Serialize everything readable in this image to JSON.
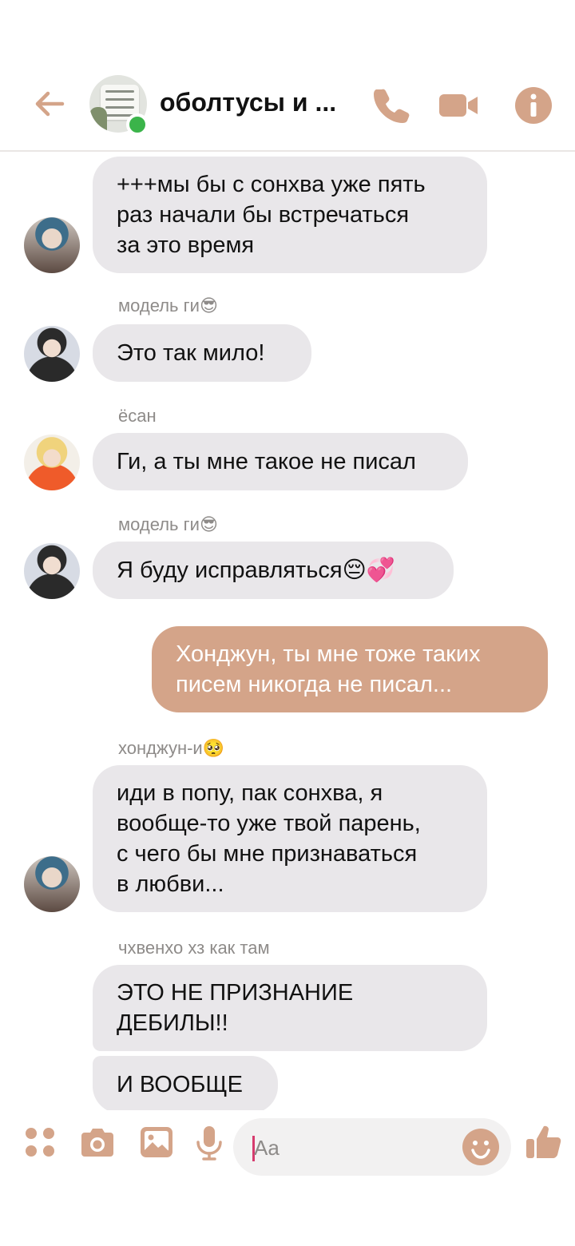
{
  "header": {
    "title": "оболтусы и ...",
    "accent_color": "#d4a489",
    "icons": [
      "back-arrow-icon",
      "phone-icon",
      "video-camera-icon",
      "info-icon"
    ]
  },
  "messages": [
    {
      "sender": "",
      "direction": "in",
      "lines": "+++мы бы с сонхва уже пять\nраз начали бы встречаться\nза это время"
    },
    {
      "sender": "модель ги😎",
      "direction": "in",
      "text": "Это так мило!"
    },
    {
      "sender": "ёсан",
      "direction": "in",
      "text": "Ги, а ты мне такое не писал"
    },
    {
      "sender": "модель ги😎",
      "direction": "in",
      "text": "Я буду исправляться😔💞"
    },
    {
      "sender": "",
      "direction": "out",
      "lines": "Хонджун, ты мне тоже таких\nписем никогда не писал..."
    },
    {
      "sender": "хонджун-и🥺",
      "direction": "in",
      "lines": "иди в попу, пак сонхва, я\nвообще-то уже твой парень,\nс чего бы мне признаваться\nв любви..."
    },
    {
      "sender": "чхвенхо хз как там",
      "direction": "in",
      "lines": "ЭТО НЕ ПРИЗНАНИЕ\nДЕБИЛЫ!!"
    },
    {
      "sender": "",
      "direction": "in",
      "text": "И ВООБЩЕ"
    }
  ],
  "composer": {
    "placeholder": "Aa",
    "icons": [
      "apps-icon",
      "camera-icon",
      "gallery-icon",
      "microphone-icon",
      "emoji-icon",
      "thumbs-up-icon"
    ]
  }
}
